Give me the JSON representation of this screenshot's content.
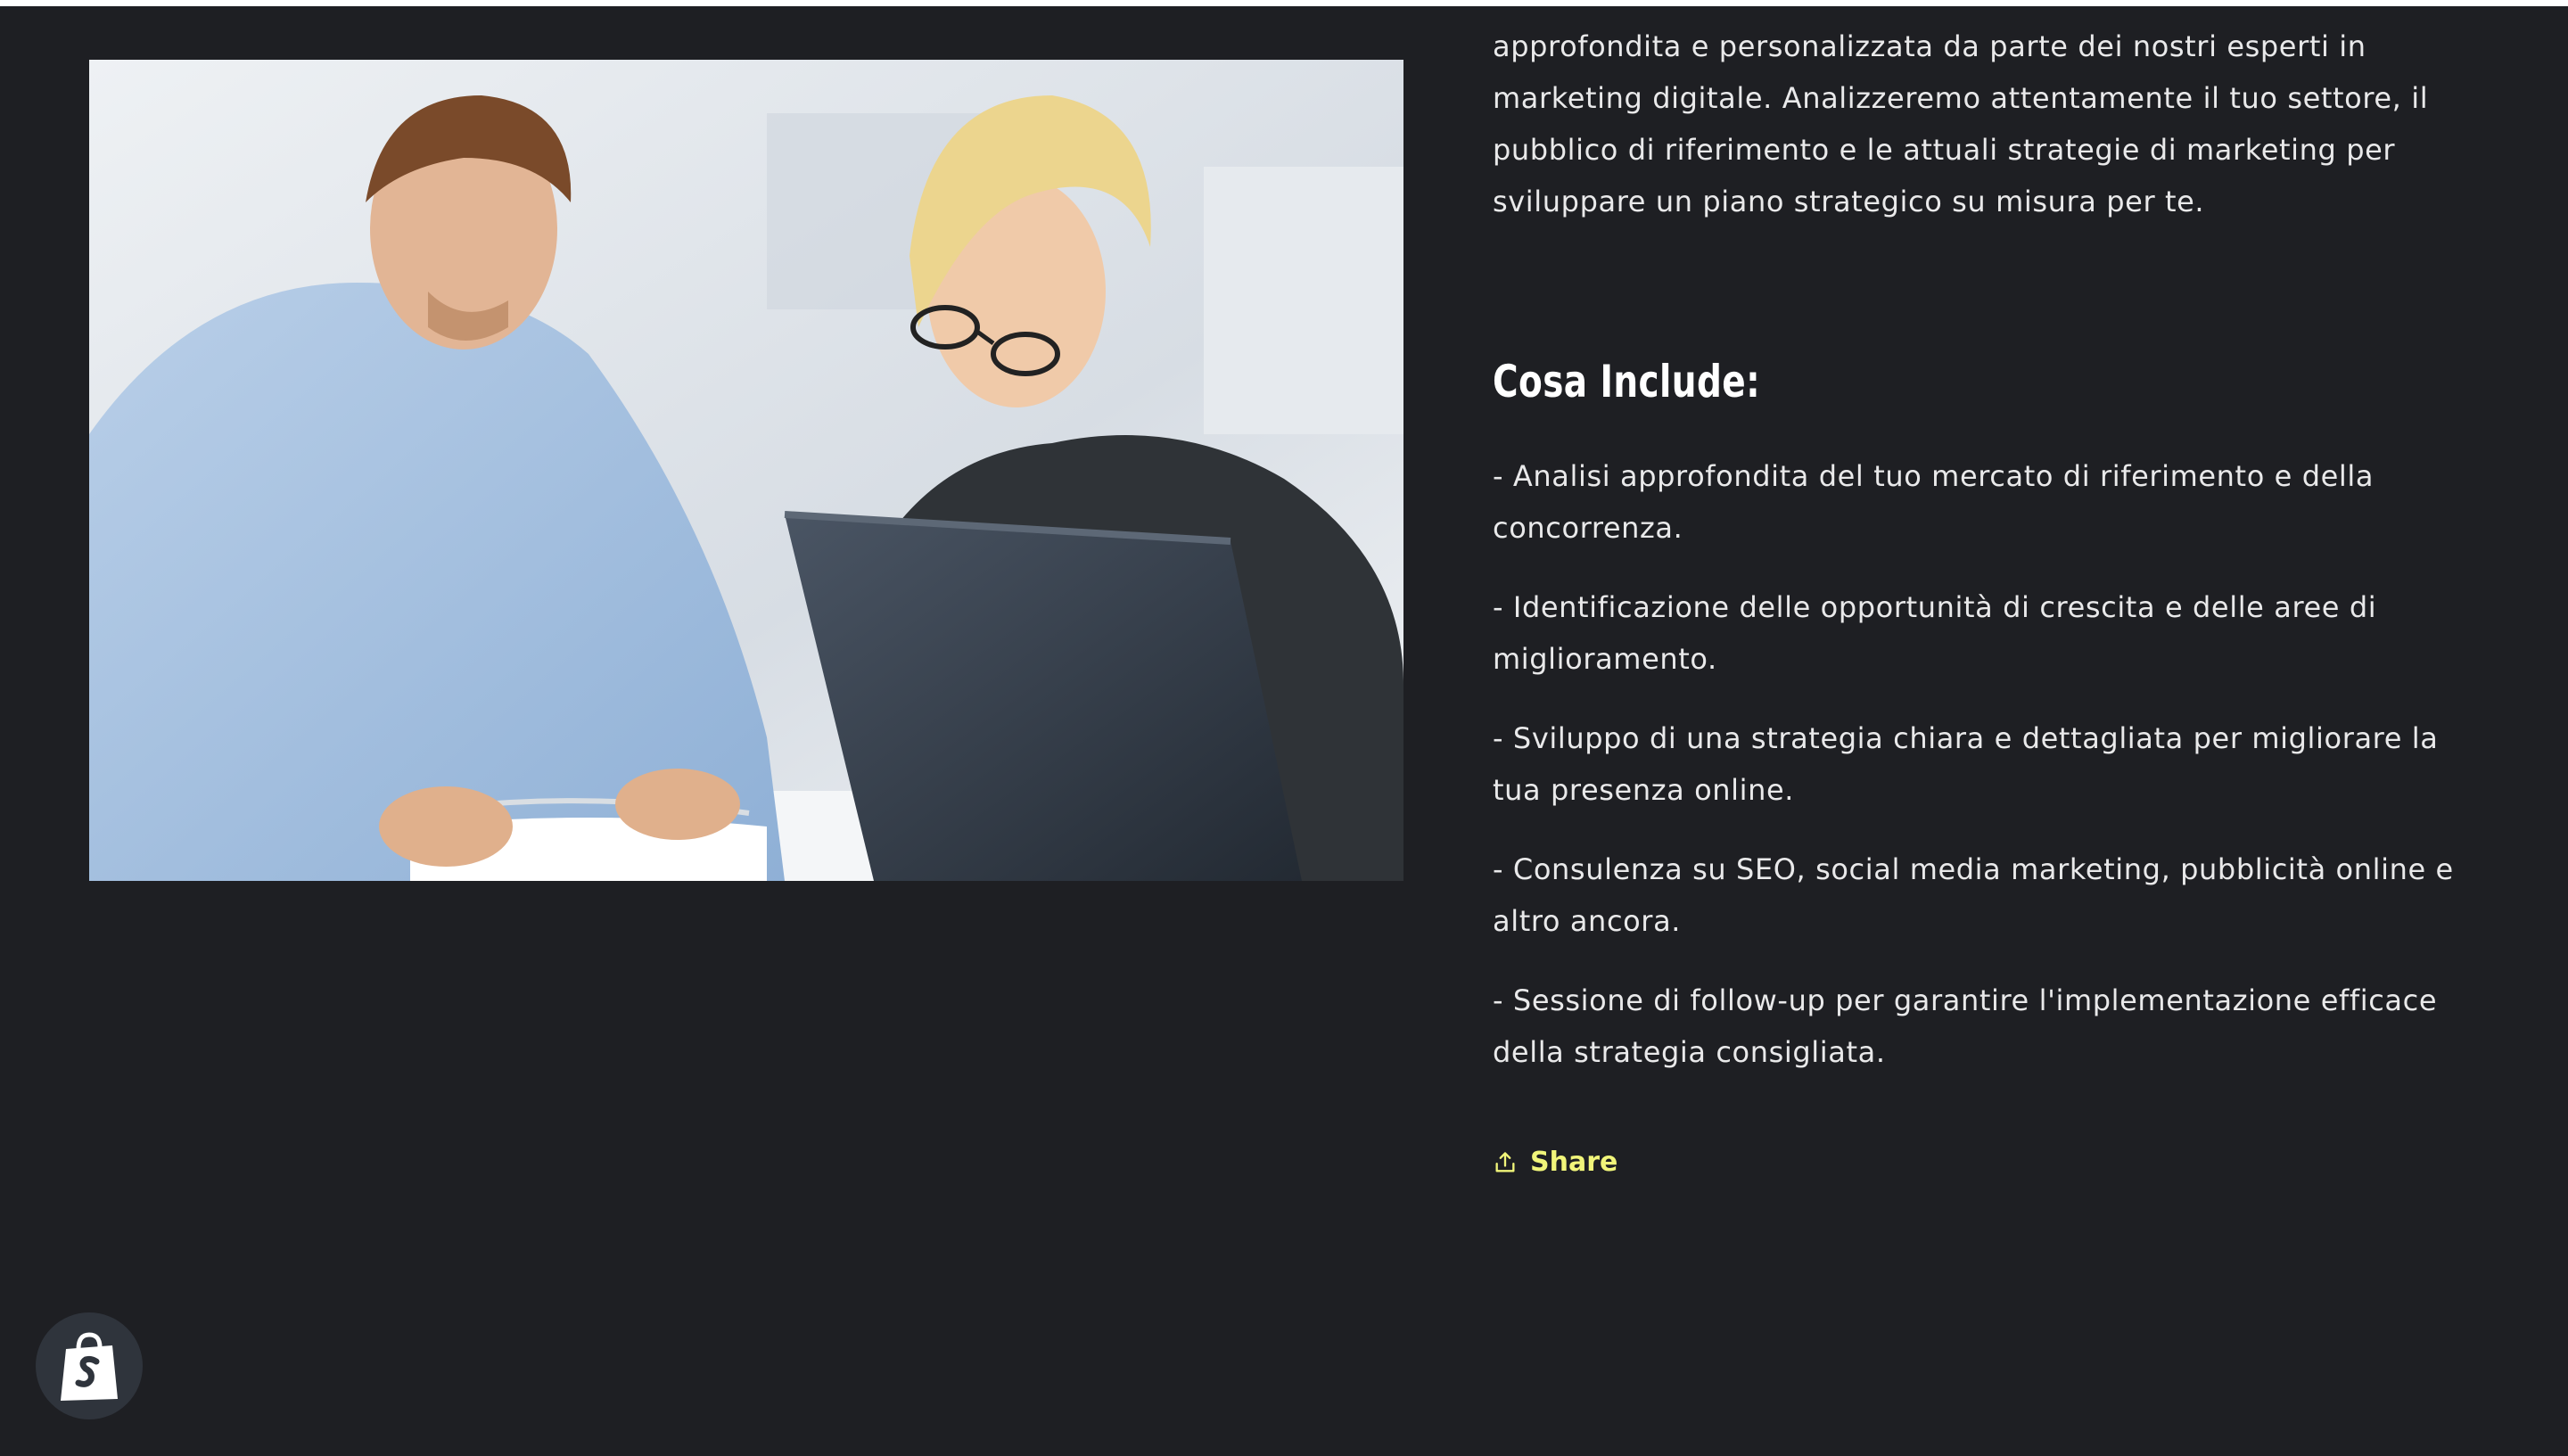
{
  "page": {
    "colors": {
      "background": "#1e1f23",
      "text": "#e9e9ea",
      "accent": "#f1f57a",
      "badge": "#2f343c"
    }
  },
  "hero_image": {
    "alt": "Due persone che consultano un documento davanti a un computer portatile"
  },
  "description": {
    "cut_line": "[line clipped at top edge]",
    "intro": "approfondita e personalizzata da parte dei nostri esperti in marketing digitale. Analizzeremo attentamente il tuo settore, il pubblico di riferimento e le attuali strategie di marketing per sviluppare un piano strategico su misura per te."
  },
  "includes": {
    "heading": "Cosa Include:",
    "items": [
      "- Analisi approfondita del tuo mercato di riferimento e della concorrenza.",
      "- Identificazione delle opportunità di crescita e delle aree di miglioramento.",
      "- Sviluppo di una strategia chiara e dettagliata per migliorare la tua presenza online.",
      "- Consulenza su SEO, social media marketing, pubblicità online e altro ancora.",
      "- Sessione di follow-up per garantire l'implementazione efficace della strategia consigliata."
    ]
  },
  "share": {
    "label": "Share",
    "icon": "share-icon"
  },
  "shopify": {
    "icon": "shopify-bag-icon"
  }
}
